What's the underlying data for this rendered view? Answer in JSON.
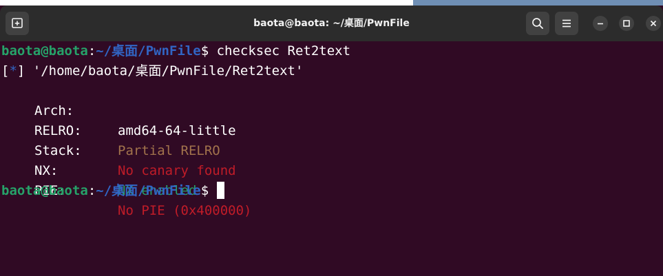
{
  "window": {
    "title": "baota@baota: ~/桌面/PwnFile"
  },
  "icons": {
    "new_tab": "new-tab-icon",
    "search": "search-icon",
    "menu": "hamburger-menu-icon",
    "minimize": "minimize-icon",
    "maximize": "maximize-icon",
    "close": "close-icon"
  },
  "colors": {
    "terminal_bg": "#300a24",
    "titlebar_bg": "#2c2c2c",
    "prompt_user": "#26a269",
    "prompt_path": "#3165c4",
    "warning": "#a2734c",
    "error": "#c01c28",
    "ok": "#26a269"
  },
  "prompt": {
    "user_host": "baota@baota",
    "separator": ":",
    "path": "~/桌面/PwnFile",
    "symbol": "$"
  },
  "command": " checksec Ret2text",
  "output": {
    "file_marker_open": "[",
    "file_marker_star": "*",
    "file_marker_close": "]",
    "file_path": " '/home/baota/桌面/PwnFile/Ret2text'",
    "rows": [
      {
        "label": "Arch:",
        "value": "amd64-64-little",
        "status": "neutral"
      },
      {
        "label": "RELRO:",
        "value": "Partial RELRO",
        "status": "warning"
      },
      {
        "label": "Stack:",
        "value": "No canary found",
        "status": "error"
      },
      {
        "label": "NX:",
        "value": "NX enabled",
        "status": "ok"
      },
      {
        "label": "PIE:",
        "value": "No PIE (0x400000)",
        "status": "error"
      }
    ]
  }
}
